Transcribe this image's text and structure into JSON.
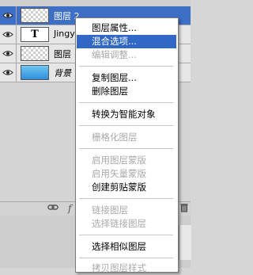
{
  "top_partial_text": "",
  "layers": [
    {
      "name": "图层 2",
      "type": "checker",
      "selected": true
    },
    {
      "name": "Jingya",
      "type": "text",
      "selected": false
    },
    {
      "name": "图层",
      "type": "checker",
      "selected": false
    },
    {
      "name": "背景",
      "type": "gradient",
      "selected": false,
      "italic": true
    }
  ],
  "bottom_icons": [
    "link-icon",
    "fx-icon",
    "new-layer-icon",
    "trash-icon"
  ],
  "menu": {
    "items": [
      {
        "label": "图层属性...",
        "enabled": true,
        "highlighted": false
      },
      {
        "label": "混合选项...",
        "enabled": true,
        "highlighted": true
      },
      {
        "label": "编辑调整...",
        "enabled": false,
        "highlighted": false
      },
      {
        "label": "复制图层...",
        "enabled": true,
        "highlighted": false
      },
      {
        "label": "删除图层",
        "enabled": true,
        "highlighted": false
      },
      {
        "label": "转换为智能对象",
        "enabled": true,
        "highlighted": false
      },
      {
        "label": "栅格化图层",
        "enabled": false,
        "highlighted": false
      },
      {
        "label": "启用图层蒙版",
        "enabled": false,
        "highlighted": false
      },
      {
        "label": "启用矢量蒙版",
        "enabled": false,
        "highlighted": false
      },
      {
        "label": "创建剪贴蒙版",
        "enabled": true,
        "highlighted": false
      },
      {
        "label": "链接图层",
        "enabled": false,
        "highlighted": false
      },
      {
        "label": "选择链接图层",
        "enabled": false,
        "highlighted": false
      },
      {
        "label": "选择相似图层",
        "enabled": true,
        "highlighted": false
      },
      {
        "label": "拷贝图层样式",
        "enabled": false,
        "highlighted": false
      }
    ]
  },
  "colors": {
    "selection": "#3168c5",
    "disabled_text": "#a9a9a9",
    "menu_bg": "#ffffff"
  }
}
